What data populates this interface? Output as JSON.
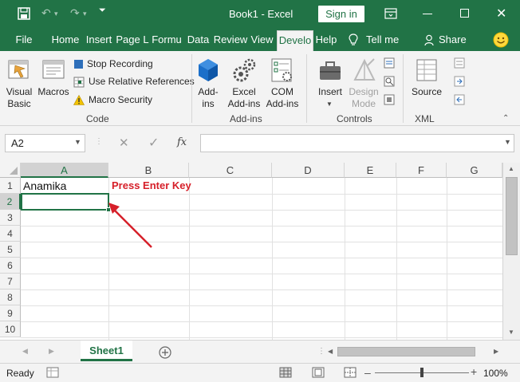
{
  "titlebar": {
    "title": "Book1  -  Excel",
    "signin": "Sign in"
  },
  "tabs": [
    "File",
    "Home",
    "Insert",
    "Page L",
    "Formu",
    "Data",
    "Review",
    "View",
    "Develo",
    "Help"
  ],
  "tell_me": "Tell me",
  "share": "Share",
  "ribbon": {
    "visual_basic_1": "Visual",
    "visual_basic_2": "Basic",
    "macros": "Macros",
    "stop_recording": "Stop Recording",
    "relative_refs": "Use Relative References",
    "macro_security": "Macro Security",
    "group_code": "Code",
    "addins_1": "Add-",
    "addins_2": "ins",
    "excel_addins_1": "Excel",
    "excel_addins_2": "Add-ins",
    "com_addins_1": "COM",
    "com_addins_2": "Add-ins",
    "group_addins": "Add-ins",
    "insert": "Insert",
    "design_mode_1": "Design",
    "design_mode_2": "Mode",
    "group_controls": "Controls",
    "source": "Source",
    "group_xml": "XML"
  },
  "formula_bar": {
    "name_box": "A2",
    "fx": "fx",
    "value": ""
  },
  "grid": {
    "columns": [
      "A",
      "B",
      "C",
      "D",
      "E",
      "F",
      "G"
    ],
    "rows": [
      "1",
      "2",
      "3",
      "4",
      "5",
      "6",
      "7",
      "8",
      "9",
      "10"
    ],
    "a1": "Anamika",
    "annotation": "Press Enter Key"
  },
  "sheet": {
    "tab": "Sheet1"
  },
  "status": {
    "ready": "Ready",
    "zoom": "100%"
  },
  "colors": {
    "brand": "#217346",
    "annotation": "#d6202a"
  }
}
